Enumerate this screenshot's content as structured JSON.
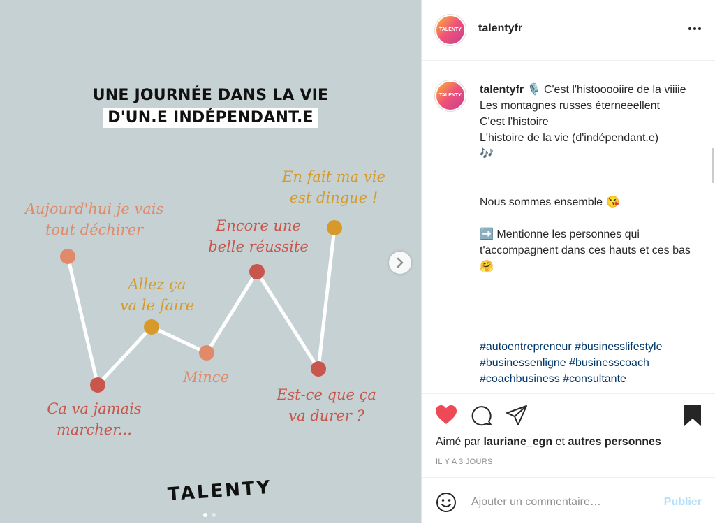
{
  "post": {
    "title_line1": "UNE JOURNÉE DANS LA VIE",
    "title_line2": "D'UN.E INDÉPENDANT.E",
    "labels": {
      "l1a": "Aujourd'hui je vais",
      "l1b": "tout déchirer",
      "l2a": "Ca va jamais",
      "l2b": "marcher...",
      "l3a": "Allez ça",
      "l3b": "va le faire",
      "l4": "Mince",
      "l5a": "Encore une",
      "l5b": "belle réussite",
      "l6a": "Est-ce que ça",
      "l6b": "va durer ?",
      "l7a": "En fait ma vie",
      "l7b": "est dingue !"
    },
    "brand": "TALENTY",
    "colors": {
      "orange": "#e08a6a",
      "red": "#c8564d",
      "gold": "#d79a2a",
      "background": "#c5d1d2"
    }
  },
  "sidebar": {
    "avatar_text": "TALENTY",
    "username": "talentyfr",
    "caption": {
      "username": "talentyfr",
      "line1": "🎙️ C'est l'histooooiire de la viiiie",
      "line2": "Les montagnes russes éterneeellent",
      "line3": "C'est l'histoire",
      "line4": "L'histoire de la vie (d'indépendant.e)",
      "line5": "🎶",
      "line6": "Nous sommes ensemble 😘",
      "line7": "➡️ Mentionne les personnes qui t'accompagnent dans ces hauts et ces bas 🤗",
      "tags1": "#autoentrepreneur #businesslifestyle",
      "tags2": "#businessenligne #businesscoach",
      "tags3": "#coachbusiness #consultante"
    },
    "likes_prefix": "Aimé par",
    "likes_user": "lauriane_egn",
    "likes_and": "et",
    "likes_others": "autres personnes",
    "time": "IL Y A 3 JOURS",
    "comment_placeholder": "Ajouter un commentaire…",
    "publish_label": "Publier"
  }
}
